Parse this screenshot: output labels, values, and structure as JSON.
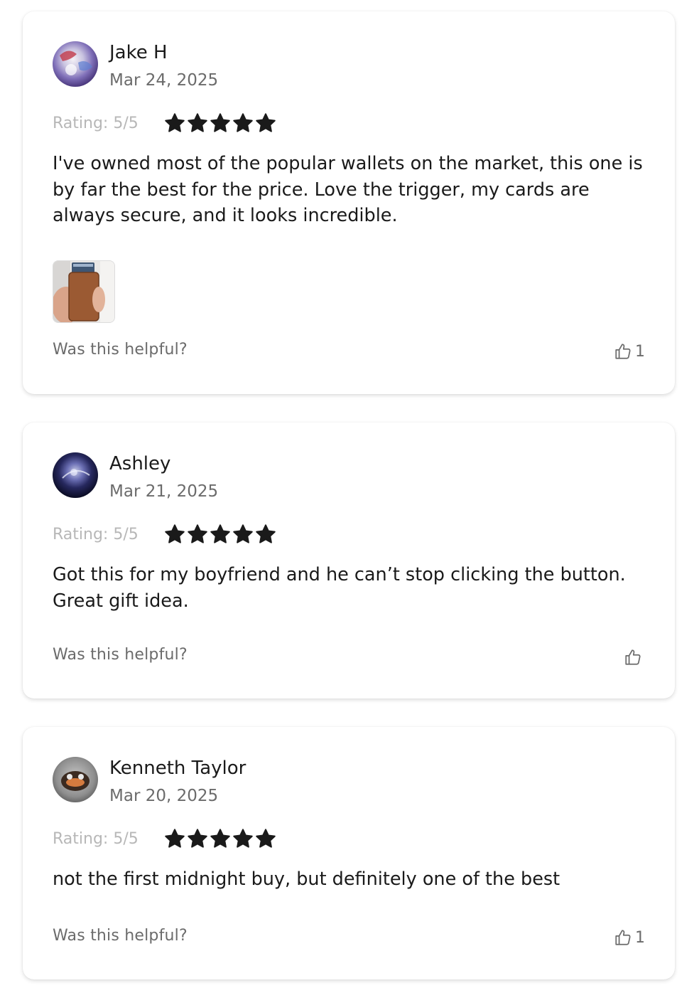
{
  "reviews": [
    {
      "author": "Jake H",
      "date": "Mar 24, 2025",
      "rating_label": "Rating: 5/5",
      "rating": 5,
      "body": "I've owned most of the popular wallets on the market, this one is by far the best for the price. Love the trigger, my cards are always secure, and it looks incredible.",
      "helpful_label": "Was this helpful?",
      "helpful_count": "1",
      "avatar_icon": "avatar-image",
      "has_photo": true
    },
    {
      "author": "Ashley",
      "date": "Mar 21, 2025",
      "rating_label": "Rating: 5/5",
      "rating": 5,
      "body": "Got this for my boyfriend and he can’t stop clicking the button. Great gift idea.",
      "helpful_label": "Was this helpful?",
      "helpful_count": "",
      "avatar_icon": "avatar-image",
      "has_photo": false
    },
    {
      "author": "Kenneth Taylor",
      "date": "Mar 20, 2025",
      "rating_label": "Rating: 5/5",
      "rating": 5,
      "body": "not the first midnight buy, but definitely one of the best",
      "helpful_label": "Was this helpful?",
      "helpful_count": "1",
      "avatar_icon": "avatar-image",
      "has_photo": false
    }
  ],
  "icons": {
    "star": "star-icon",
    "helpful": "thumbs-up-icon"
  },
  "colors": {
    "star": "#1a1a1a",
    "text": "#1a1a1a",
    "muted": "#6b6b6b",
    "rating_label": "#b7b7b7"
  }
}
